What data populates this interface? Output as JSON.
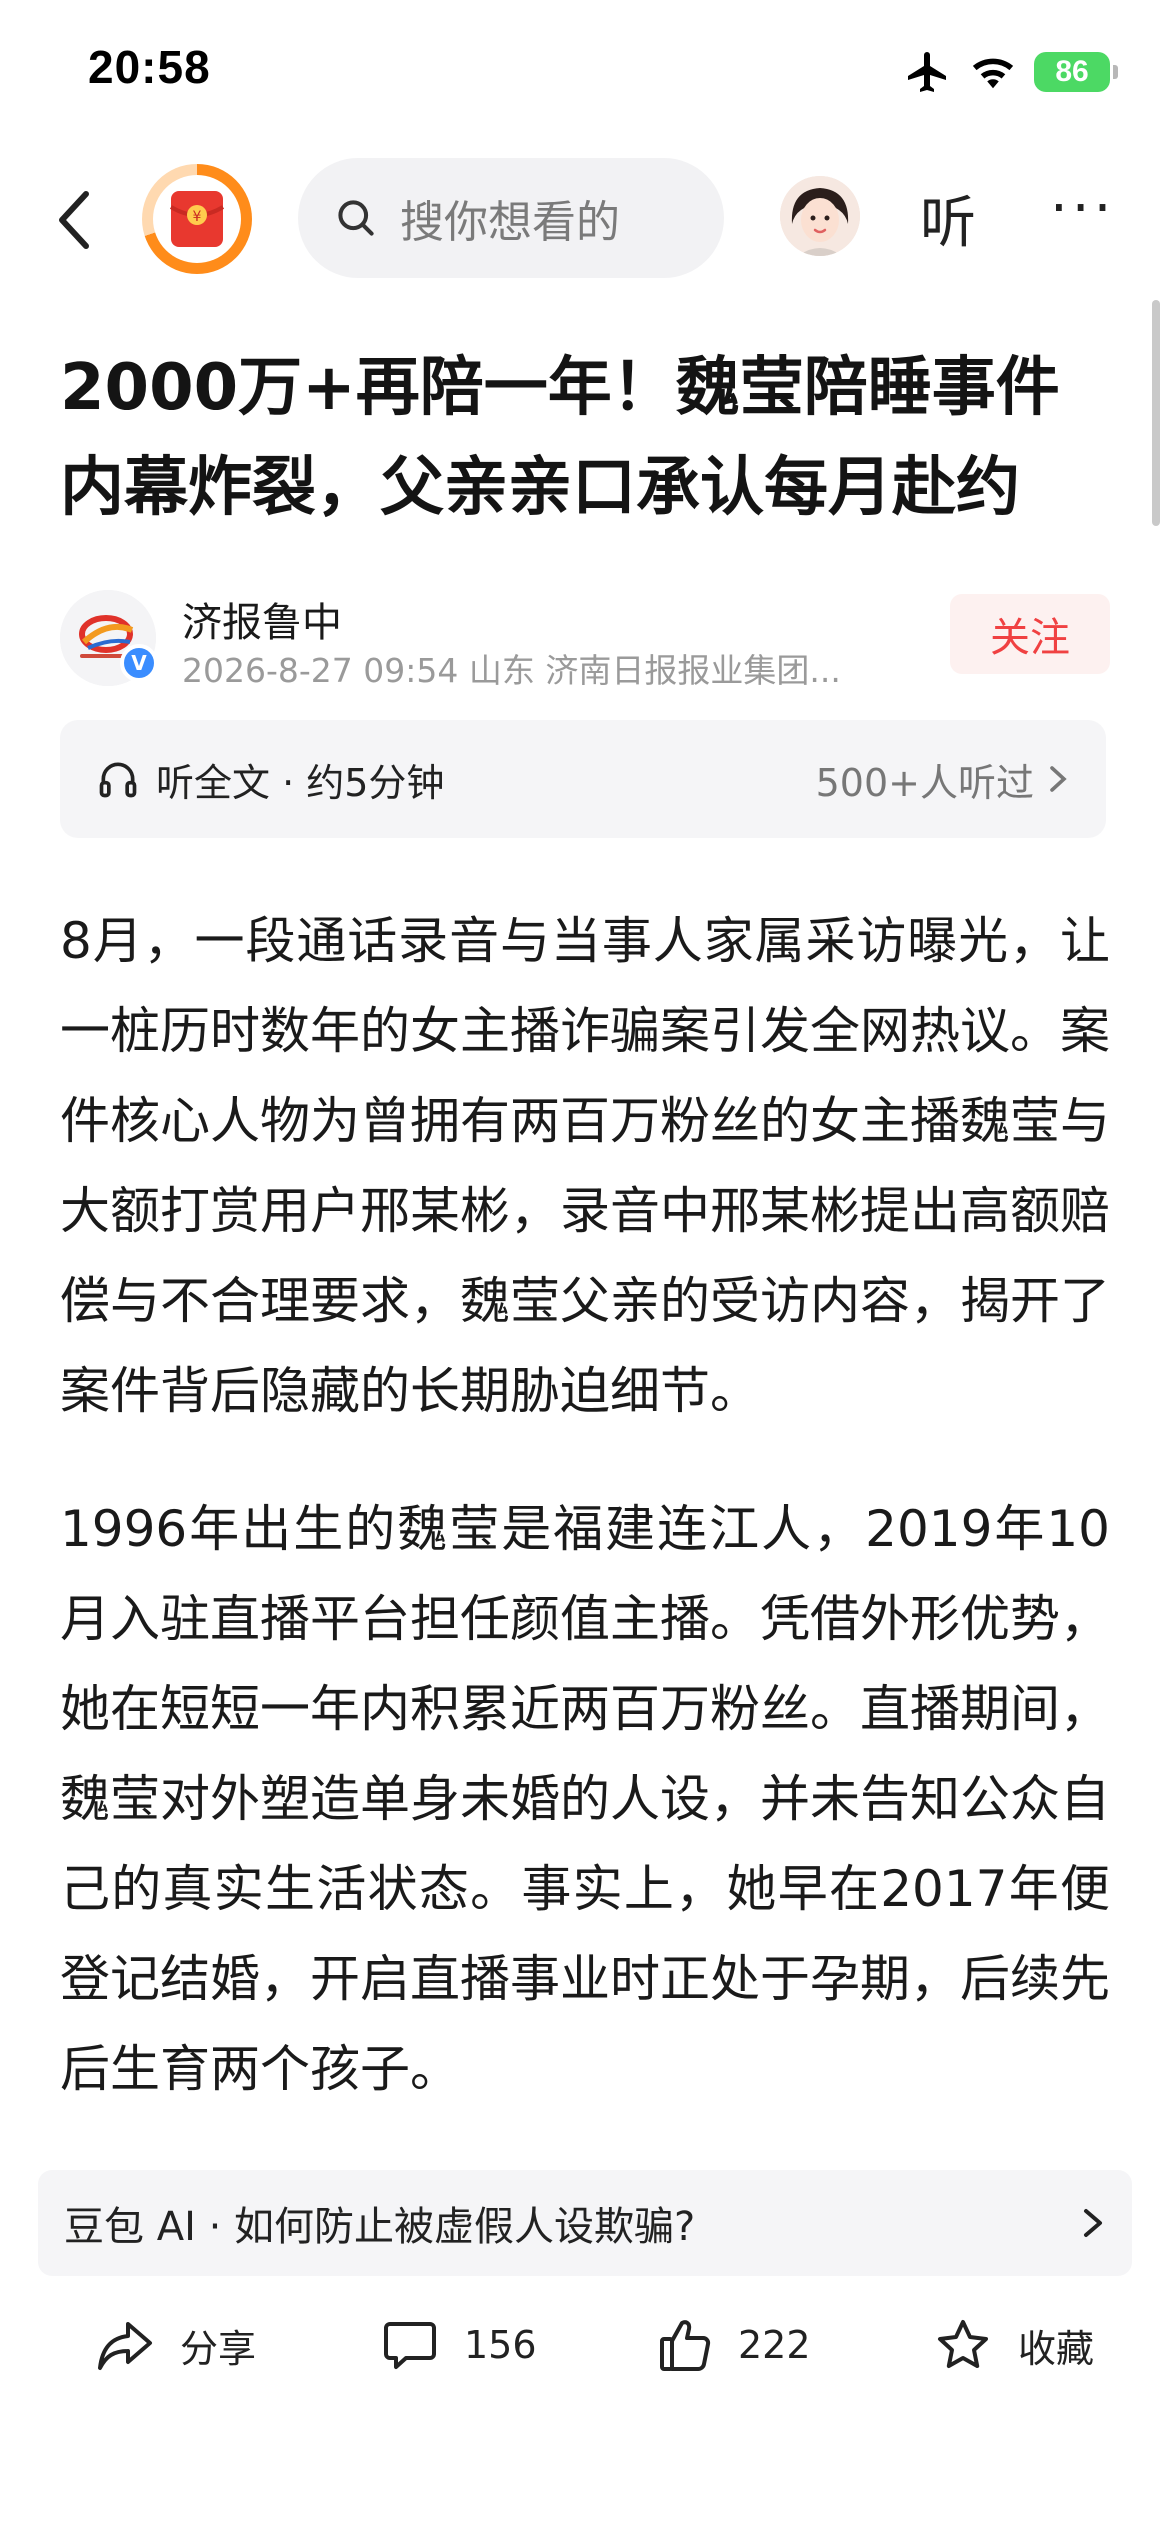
{
  "status": {
    "time": "20:58",
    "battery": "86"
  },
  "nav": {
    "search_placeholder": "搜你想看的",
    "listen_label": "听",
    "more_label": "···"
  },
  "article": {
    "title": "2000万+再陪一年！魏莹陪睡事件内幕炸裂，父亲亲口承认每月赴约",
    "author": {
      "name": "济报鲁中",
      "meta": "2026-8-27  09:54  山东  济南日报报业集团...",
      "follow_label": "关注"
    },
    "listen_card": {
      "left": "听全文 · 约5分钟",
      "right": "500+人听过"
    },
    "paragraphs": [
      "8月，一段通话录音与当事人家属采访曝光，让一桩历时数年的女主播诈骗案引发全网热议。案件核心人物为曾拥有两百万粉丝的女主播魏莹与大额打赏用户邢某彬，录音中邢某彬提出高额赔偿与不合理要求，魏莹父亲的受访内容，揭开了案件背后隐藏的长期胁迫细节。",
      "1996年出生的魏莹是福建连江人，2019年10月入驻直播平台担任颜值主播。凭借外形优势，她在短短一年内积累近两百万粉丝。直播期间，魏莹对外塑造单身未婚的人设，并未告知公众自己的真实生活状态。事实上，她早在2017年便登记结婚，开启直播事业时正处于孕期，后续先后生育两个孩子。"
    ]
  },
  "ai_bar": {
    "text": "豆包 AI · 如何防止被虚假人设欺骗?"
  },
  "actions": {
    "share_label": "分享",
    "comment_count": "156",
    "like_count": "222",
    "favorite_label": "收藏"
  },
  "icons": {
    "status": [
      "airplane-icon",
      "wifi-icon",
      "battery-icon"
    ],
    "nav": [
      "back-icon",
      "red-packet-icon",
      "search-icon",
      "avatar",
      "more-icon"
    ],
    "actions": [
      "share-icon",
      "comment-icon",
      "like-icon",
      "star-icon"
    ]
  },
  "colors": {
    "follow_text": "#f04142",
    "verify_badge": "#3a8dff",
    "battery": "#4cd964",
    "red_packet_ring": "#ff8c1a"
  }
}
